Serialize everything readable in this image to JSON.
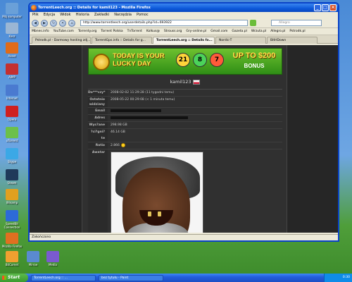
{
  "desktop": {
    "icons": [
      {
        "label": "Mój komputer",
        "color": "#6aa0d8"
      },
      {
        "label": "Kosz",
        "color": "#9bb6d4"
      },
      {
        "label": "Avast",
        "color": "#e06b1a"
      },
      {
        "label": "AIMP",
        "color": "#c43030"
      },
      {
        "label": "Internet",
        "color": "#4a7ad0"
      },
      {
        "label": "Opera",
        "color": "#cf2020"
      },
      {
        "label": "uTorrent",
        "color": "#6cc04a"
      },
      {
        "label": "Skype",
        "color": "#3ba8e6"
      },
      {
        "label": "Steam",
        "color": "#1f3a5a"
      },
      {
        "label": "Winamp",
        "color": "#e0a020"
      },
      {
        "label": "SpeedBit Connection",
        "color": "#2d6ad8"
      },
      {
        "label": "Mozilla Firefox",
        "color": "#e07020"
      },
      {
        "label": "BitComet",
        "color": "#f0a030"
      },
      {
        "label": "Mirroe",
        "color": "#5a8ad0"
      },
      {
        "label": "Media",
        "color": "#7a5ad0"
      }
    ]
  },
  "window": {
    "title": "TorrentLeech.org :: Details for kamil123 - Mozilla Firefox",
    "menu": [
      "Plik",
      "Edycja",
      "Widok",
      "Historia",
      "Zakładki",
      "Narzędzia",
      "Pomoc"
    ],
    "url": "http://www.torrentleech.org/userdetails.php?id=693922",
    "search_placeholder": "Allegro",
    "bookmarks": [
      "Mbnes.info",
      "YouTube.com",
      "Torrenty.org",
      "Torrent Polska",
      "TnTorrent",
      "Kolkus@",
      "Strouss.org",
      "Gry-online.pl",
      "Gmail.com",
      "Gazeta.pl",
      "Wrzuta.pl",
      "Allegro.pl",
      "Pstrodk.pl"
    ],
    "tabs": [
      "Pstrodk.pl - Darmowy hosting zdj...",
      "TorrentGps.info :: Details for g...",
      "TorrentLeech.org :: Details fo...",
      "Nordic-T",
      "BitHDown"
    ],
    "active_tab_index": 2,
    "status": "Zakończono"
  },
  "banner": {
    "line1": "TODAY IS YOUR LUCKY DAY",
    "line2": "UP TO $200",
    "line3": "BONUS",
    "balls": [
      "21",
      "8",
      "7"
    ]
  },
  "profile": {
    "username": "kamil123",
    "rows": [
      {
        "label": "Do***czy*",
        "value": "2008-02-02 11:29:28 (11 tygodni temu)"
      },
      {
        "label": "Ostatnio widziany",
        "value": "2008-05-22 00:29:08 (< 1 minuta temu)"
      },
      {
        "label": "Email",
        "value": ""
      },
      {
        "label": "Adres",
        "value": ""
      },
      {
        "label": "Wys?ane",
        "value": "298.98 GB"
      },
      {
        "label": "?ci?gni?te",
        "value": "46.14 GB"
      },
      {
        "label": "Ratio",
        "value": "2.866"
      },
      {
        "label": "Awatar",
        "value": ""
      }
    ]
  },
  "taskbar": {
    "start": "Start",
    "tasks": [
      "TorrentLeech.org :: ...",
      "bez tytułu - Paint"
    ],
    "clock": "0:30"
  },
  "colors": {
    "accent": "#0a43c8",
    "page_bg": "#262626",
    "banner_green": "#2f8e16",
    "banner_yellow": "#ffe24a"
  }
}
